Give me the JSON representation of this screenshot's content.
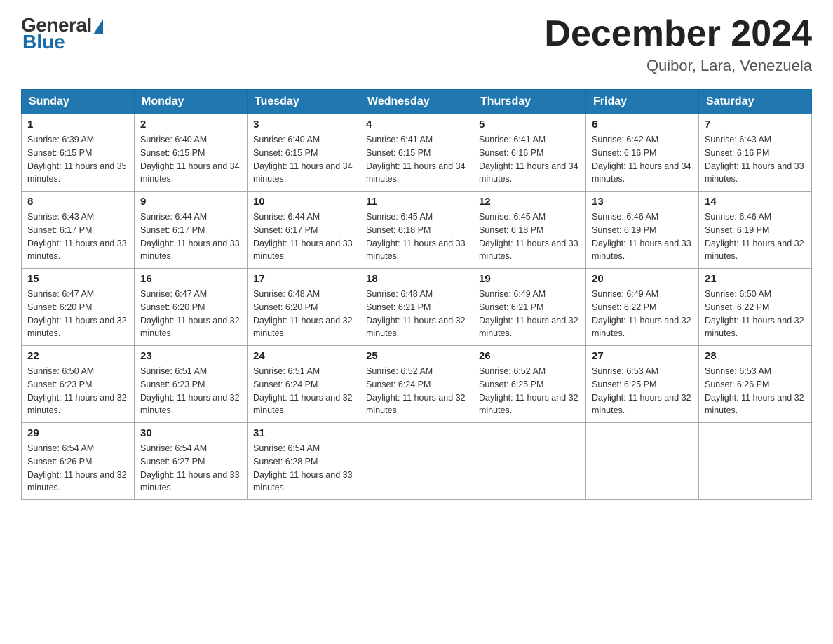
{
  "logo": {
    "general": "General",
    "blue": "Blue"
  },
  "header": {
    "title": "December 2024",
    "location": "Quibor, Lara, Venezuela"
  },
  "columns": [
    "Sunday",
    "Monday",
    "Tuesday",
    "Wednesday",
    "Thursday",
    "Friday",
    "Saturday"
  ],
  "weeks": [
    [
      {
        "day": "1",
        "sunrise": "6:39 AM",
        "sunset": "6:15 PM",
        "daylight": "11 hours and 35 minutes."
      },
      {
        "day": "2",
        "sunrise": "6:40 AM",
        "sunset": "6:15 PM",
        "daylight": "11 hours and 34 minutes."
      },
      {
        "day": "3",
        "sunrise": "6:40 AM",
        "sunset": "6:15 PM",
        "daylight": "11 hours and 34 minutes."
      },
      {
        "day": "4",
        "sunrise": "6:41 AM",
        "sunset": "6:15 PM",
        "daylight": "11 hours and 34 minutes."
      },
      {
        "day": "5",
        "sunrise": "6:41 AM",
        "sunset": "6:16 PM",
        "daylight": "11 hours and 34 minutes."
      },
      {
        "day": "6",
        "sunrise": "6:42 AM",
        "sunset": "6:16 PM",
        "daylight": "11 hours and 34 minutes."
      },
      {
        "day": "7",
        "sunrise": "6:43 AM",
        "sunset": "6:16 PM",
        "daylight": "11 hours and 33 minutes."
      }
    ],
    [
      {
        "day": "8",
        "sunrise": "6:43 AM",
        "sunset": "6:17 PM",
        "daylight": "11 hours and 33 minutes."
      },
      {
        "day": "9",
        "sunrise": "6:44 AM",
        "sunset": "6:17 PM",
        "daylight": "11 hours and 33 minutes."
      },
      {
        "day": "10",
        "sunrise": "6:44 AM",
        "sunset": "6:17 PM",
        "daylight": "11 hours and 33 minutes."
      },
      {
        "day": "11",
        "sunrise": "6:45 AM",
        "sunset": "6:18 PM",
        "daylight": "11 hours and 33 minutes."
      },
      {
        "day": "12",
        "sunrise": "6:45 AM",
        "sunset": "6:18 PM",
        "daylight": "11 hours and 33 minutes."
      },
      {
        "day": "13",
        "sunrise": "6:46 AM",
        "sunset": "6:19 PM",
        "daylight": "11 hours and 33 minutes."
      },
      {
        "day": "14",
        "sunrise": "6:46 AM",
        "sunset": "6:19 PM",
        "daylight": "11 hours and 32 minutes."
      }
    ],
    [
      {
        "day": "15",
        "sunrise": "6:47 AM",
        "sunset": "6:20 PM",
        "daylight": "11 hours and 32 minutes."
      },
      {
        "day": "16",
        "sunrise": "6:47 AM",
        "sunset": "6:20 PM",
        "daylight": "11 hours and 32 minutes."
      },
      {
        "day": "17",
        "sunrise": "6:48 AM",
        "sunset": "6:20 PM",
        "daylight": "11 hours and 32 minutes."
      },
      {
        "day": "18",
        "sunrise": "6:48 AM",
        "sunset": "6:21 PM",
        "daylight": "11 hours and 32 minutes."
      },
      {
        "day": "19",
        "sunrise": "6:49 AM",
        "sunset": "6:21 PM",
        "daylight": "11 hours and 32 minutes."
      },
      {
        "day": "20",
        "sunrise": "6:49 AM",
        "sunset": "6:22 PM",
        "daylight": "11 hours and 32 minutes."
      },
      {
        "day": "21",
        "sunrise": "6:50 AM",
        "sunset": "6:22 PM",
        "daylight": "11 hours and 32 minutes."
      }
    ],
    [
      {
        "day": "22",
        "sunrise": "6:50 AM",
        "sunset": "6:23 PM",
        "daylight": "11 hours and 32 minutes."
      },
      {
        "day": "23",
        "sunrise": "6:51 AM",
        "sunset": "6:23 PM",
        "daylight": "11 hours and 32 minutes."
      },
      {
        "day": "24",
        "sunrise": "6:51 AM",
        "sunset": "6:24 PM",
        "daylight": "11 hours and 32 minutes."
      },
      {
        "day": "25",
        "sunrise": "6:52 AM",
        "sunset": "6:24 PM",
        "daylight": "11 hours and 32 minutes."
      },
      {
        "day": "26",
        "sunrise": "6:52 AM",
        "sunset": "6:25 PM",
        "daylight": "11 hours and 32 minutes."
      },
      {
        "day": "27",
        "sunrise": "6:53 AM",
        "sunset": "6:25 PM",
        "daylight": "11 hours and 32 minutes."
      },
      {
        "day": "28",
        "sunrise": "6:53 AM",
        "sunset": "6:26 PM",
        "daylight": "11 hours and 32 minutes."
      }
    ],
    [
      {
        "day": "29",
        "sunrise": "6:54 AM",
        "sunset": "6:26 PM",
        "daylight": "11 hours and 32 minutes."
      },
      {
        "day": "30",
        "sunrise": "6:54 AM",
        "sunset": "6:27 PM",
        "daylight": "11 hours and 33 minutes."
      },
      {
        "day": "31",
        "sunrise": "6:54 AM",
        "sunset": "6:28 PM",
        "daylight": "11 hours and 33 minutes."
      },
      null,
      null,
      null,
      null
    ]
  ]
}
